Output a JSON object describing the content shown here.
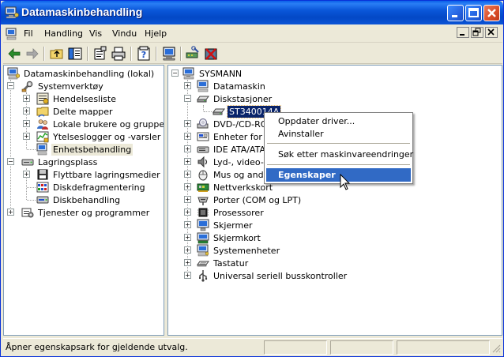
{
  "window": {
    "title": "Datamaskinbehandling",
    "accent": "#0a57d9"
  },
  "menubar": {
    "items": [
      "Fil",
      "Handling",
      "Vis",
      "Vindu",
      "Hjelp"
    ]
  },
  "toolbar": {
    "buttons": [
      "back-icon",
      "forward-icon",
      "up-folder-icon",
      "show-hide-tree-icon",
      "properties-icon",
      "print-icon",
      "help-icon",
      "computer-icon",
      "scan-hardware-icon",
      "uninstall-icon"
    ]
  },
  "left_tree": {
    "root": "Datamaskinbehandling (lokal)",
    "system_tools": "Systemverktøy",
    "event_viewer": "Hendelsesliste",
    "shared_folders": "Delte mapper",
    "local_users": "Lokale brukere og grupper",
    "perf_logs": "Ytelseslogger og -varsler",
    "device_manager": "Enhetsbehandling",
    "storage": "Lagringsplass",
    "removable": "Flyttbare lagringsmedier",
    "defrag": "Diskdefragmentering",
    "disk_mgmt": "Diskbehandling",
    "services": "Tjenester og programmer"
  },
  "right_tree": {
    "root": "SYSMANN",
    "items": [
      "Datamaskin",
      "Diskstasjoner",
      "ST340014A",
      "DVD-/CD-ROM",
      "Enheter for m",
      "IDE ATA/ATA",
      "Lyd-, video- o",
      "Mus og andre",
      "Nettverkskort",
      "Porter (COM og LPT)",
      "Prosessorer",
      "Skjermer",
      "Skjermkort",
      "Systemenheter",
      "Tastatur",
      "Universal seriell busskontroller"
    ]
  },
  "context_menu": {
    "update_driver": "Oppdater driver...",
    "uninstall": "Avinstaller",
    "scan": "Søk etter maskinvareendringer",
    "properties": "Egenskaper",
    "highlight": "#316ac5"
  },
  "statusbar": {
    "text": "Åpner egenskapsark for gjeldende utvalg."
  }
}
